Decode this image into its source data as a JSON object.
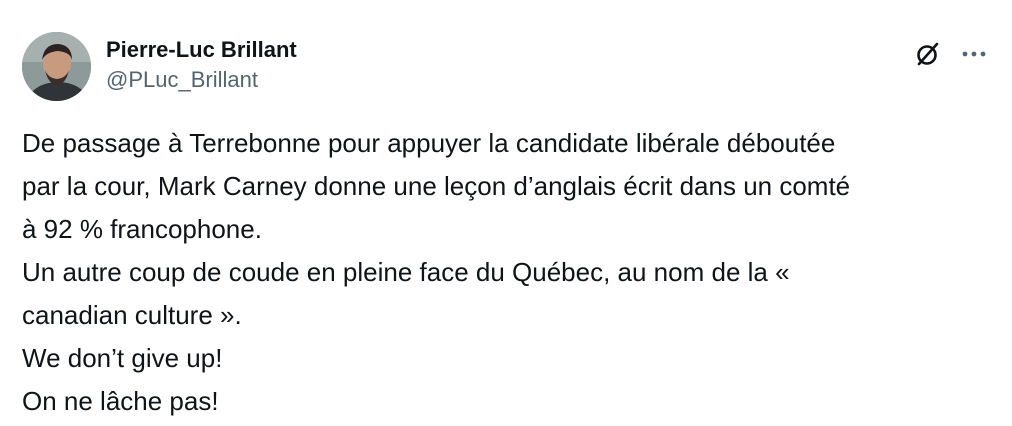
{
  "author": {
    "display_name": "Pierre-Luc Brillant",
    "handle": "@PLuc_Brillant",
    "avatar_icon": "avatar-photo"
  },
  "actions": {
    "grok_icon": "grok-icon",
    "more_icon": "more-options-icon"
  },
  "tweet": {
    "lines": [
      "De passage à Terrebonne pour appuyer la candidate libérale déboutée",
      "par la cour, Mark Carney donne une leçon d’anglais écrit dans un comté",
      "à 92 % francophone.",
      "Un autre coup de coude en pleine face du Québec, au nom de la «",
      "canadian culture ».",
      "We don’t give up!",
      "On ne lâche pas!"
    ]
  },
  "colors": {
    "text_primary": "#0f1419",
    "text_secondary": "#536471",
    "background": "#ffffff"
  }
}
